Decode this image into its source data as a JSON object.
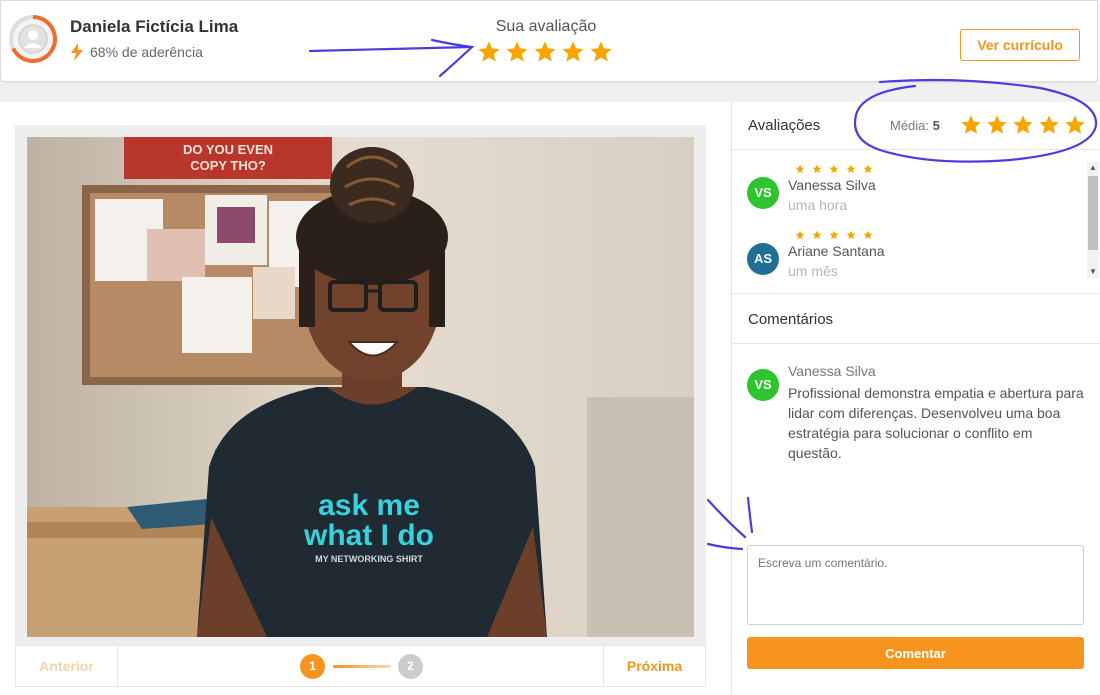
{
  "header": {
    "name": "Daniela Fictícia Lima",
    "adherence_text": "68% de aderência",
    "adherence_percent": 68,
    "your_rating_label": "Sua avaliação",
    "your_rating_stars": 5,
    "cv_button": "Ver currículo"
  },
  "photo": {
    "shirt_line1": "ask me",
    "shirt_line2": "what I do",
    "shirt_small": "MY NETWORKING SHIRT",
    "sign_line1": "DO YOU EVEN",
    "sign_line2": "COPY THO?"
  },
  "pager": {
    "prev_label": "Anterior",
    "next_label": "Próxima",
    "steps": [
      "1",
      "2"
    ],
    "current_step": 1
  },
  "ratings": {
    "title": "Avaliações",
    "average_label": "Média:",
    "average_value": "5",
    "average_stars": 5,
    "reviews": [
      {
        "initials": "VS",
        "name": "Vanessa Silva",
        "time": "uma hora",
        "stars": 5,
        "color": "#2ec42e"
      },
      {
        "initials": "AS",
        "name": "Ariane Santana",
        "time": "um mês",
        "stars": 5,
        "color": "#1f6e96"
      }
    ]
  },
  "comments": {
    "title": "Comentários",
    "items": [
      {
        "initials": "VS",
        "name": "Vanessa Silva",
        "text": "Profissional demonstra empatia e abertura para lidar com diferenças. Desenvolveu uma boa estratégia para solucionar o conflito em questão.",
        "color": "#2ec42e"
      }
    ],
    "placeholder": "Escreva um comentário.",
    "submit_label": "Comentar"
  },
  "colors": {
    "accent": "#f7941d",
    "star": "#f7a600",
    "annotation": "#4a3de0"
  }
}
